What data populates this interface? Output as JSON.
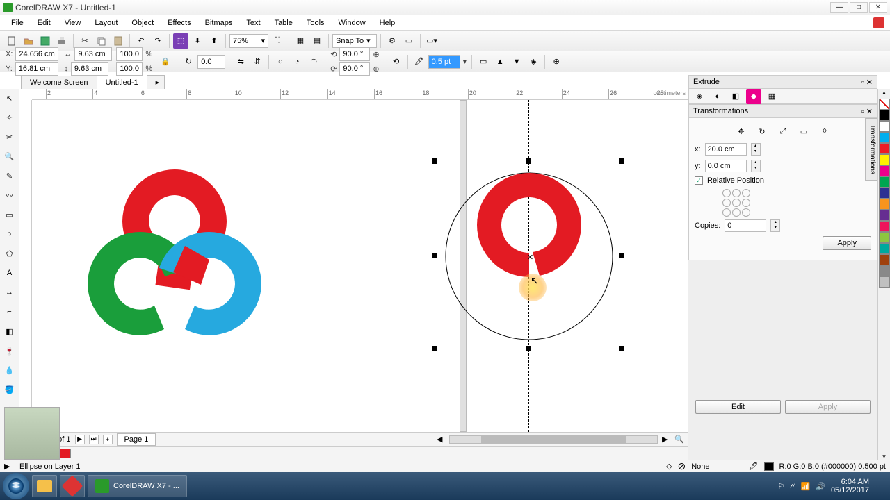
{
  "window": {
    "title": "CorelDRAW X7 - Untitled-1"
  },
  "menu": [
    "File",
    "Edit",
    "View",
    "Layout",
    "Object",
    "Effects",
    "Bitmaps",
    "Text",
    "Table",
    "Tools",
    "Window",
    "Help"
  ],
  "tabs": {
    "items": [
      "Welcome Screen",
      "Untitled-1"
    ],
    "active": 1
  },
  "property": {
    "x": "24.656 cm",
    "y": "16.81 cm",
    "w": "9.63 cm",
    "h": "9.63 cm",
    "sx": "100.0",
    "sy": "100.0",
    "pct": "%",
    "zoom": "75%",
    "snap": "Snap To",
    "rot": "0.0",
    "ang1": "90.0 °",
    "ang2": "90.0 °",
    "outline": "0.5 pt"
  },
  "ruler": {
    "unit": "centimeters",
    "ticks": [
      2,
      4,
      6,
      8,
      10,
      12,
      14,
      16,
      18,
      20,
      22,
      24,
      26,
      28
    ]
  },
  "docker": {
    "extrude": "Extrude",
    "transformations": "Transformations",
    "side_tab": "Transformations",
    "x_label": "x:",
    "x_val": "20.0 cm",
    "y_label": "y:",
    "y_val": "0.0 cm",
    "rel": "Relative Position",
    "copies_label": "Copies:",
    "copies_val": "0",
    "apply": "Apply",
    "edit": "Edit",
    "apply2": "Apply"
  },
  "palette": [
    "#000000",
    "#ffffff",
    "#00aeef",
    "#ed1c24",
    "#fff200",
    "#ec008c",
    "#00a651",
    "#2e3192",
    "#f7941d",
    "#662d91",
    "#ed145b",
    "#8dc63f",
    "#00a99d",
    "#a0410d",
    "#898989",
    "#c0c0c0"
  ],
  "page": {
    "counter": "1 of 1",
    "name": "Page 1"
  },
  "swatches": {
    "fill": "#ffffff",
    "stroke": "#ed1c24"
  },
  "status": {
    "object": "Ellipse on Layer 1",
    "none": "None",
    "color": "R:0 G:0 B:0 (#000000) 0.500 pt"
  },
  "taskbar": {
    "app": "CorelDRAW X7 - ...",
    "time": "6:04 AM",
    "date": "05/12/2017"
  }
}
